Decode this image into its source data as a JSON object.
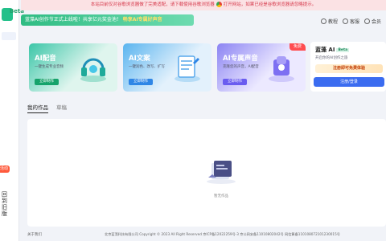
{
  "sidebar": {
    "brand_suffix": "Beta",
    "badge": "活动",
    "vertical_text": "回到旧版"
  },
  "notice": {
    "text_before": "本站目前仅对谷歌浏览器做了完美适配，请下载使用谷歌浏览器",
    "text_after": "打开网站，如果已经是谷歌浏览器请忽略提示。"
  },
  "banner": {
    "text": "蓝藻AI创作节正式上线啦！共享亿元奖金池！",
    "highlight": "畅享AI专属好声音"
  },
  "header": {
    "links": [
      "教程",
      "客服",
      "会员"
    ]
  },
  "cards": [
    {
      "title": "AI配音",
      "subtitle": "一键生成专业音频",
      "button": "立即制作"
    },
    {
      "title": "AI文案",
      "subtitle": "一键润色、改写、扩写",
      "button": "立即制作"
    },
    {
      "title": "AI专属声音",
      "subtitle": "克隆您的声音，AI配音",
      "button": "立即制作",
      "badge": "免费"
    }
  ],
  "login": {
    "name": "蓝藻 AI",
    "beta": "Beta",
    "subtitle": "开启你的AI创作之旅",
    "promo": "注册即可免费体验",
    "button": "注册/登录"
  },
  "tabs": {
    "active": "我的作品",
    "other": "草稿"
  },
  "empty": {
    "text": "暂无作品"
  },
  "footer": {
    "left": "关于我们",
    "copyright": "北京蓝藻科技有限公司 Copyright © 2023 All Right Reserved 京ICP备12022259号-3 京公网安备11010802042号 网信算备110108072101230015号"
  },
  "colors": {
    "accent_green": "#22c08a",
    "accent_blue": "#3b6cf0",
    "notice_red": "#d6394b"
  }
}
